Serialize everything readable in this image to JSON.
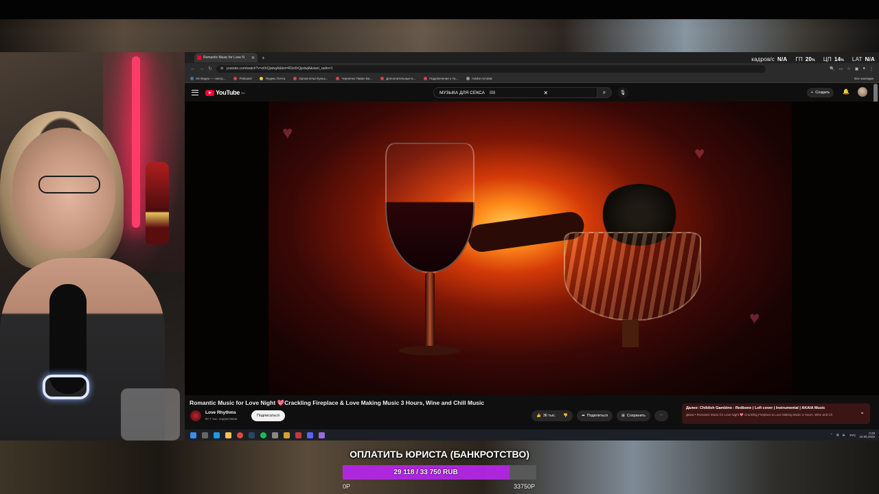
{
  "browser": {
    "tab_title": "Romantic Music for Love N",
    "url": "youtube.com/watch?v=zi0rQjwlwjA&list=RDzi0rQjwlwjA&start_radio=1",
    "bookmarks": [
      {
        "label": "VK Видео — смотр..."
      },
      {
        "label": "Pinboard"
      },
      {
        "label": "Яндекс Почта"
      },
      {
        "label": "Орлов Илья Куньк..."
      },
      {
        "label": "Черненко Павел Ва..."
      },
      {
        "label": "Дополнительные в..."
      },
      {
        "label": "Подключение к Ya..."
      },
      {
        "label": "Adobe Acrobat"
      }
    ],
    "all_bookmarks": "Все закладки"
  },
  "overlay": {
    "fps_label": "кадров/с",
    "fps_value": "N/A",
    "gpu_label": "ГП",
    "gpu_value": "20",
    "cpu_label": "ЦП",
    "cpu_value": "14",
    "lat_label": "LAT",
    "lat_value": "N/A"
  },
  "youtube": {
    "logo_text": "YouTube",
    "logo_region": "RU",
    "search_query": "МУЗЫКА ДЛЯ СЕКСА",
    "create_label": "Создать",
    "video_title": "Romantic Music for Love Night 💖Crackling Fireplace & Love Making Music 3 Hours, Wine and Chill Music",
    "channel_name": "Love Rhythms",
    "channel_subs": "87,7 тыс. подписчиков",
    "subscribe_label": "Подписаться",
    "likes": "36 тыс.",
    "share_label": "Поделиться",
    "save_label": "Сохранить",
    "next_title": "Далее: Childish Gambino - Redbone | Lofi cover | Instrumental | AKAIA Music",
    "next_sub": "Джем • Romantic Music for Love Night 💖 Crackling Fireplace & Love Making Music 3 Hours, Wine and Ch"
  },
  "taskbar": {
    "lang": "РУС",
    "time": "0:29",
    "date": "10.05.2025"
  },
  "donation": {
    "title": "ОПЛАТИТЬ ЮРИСТА (БАНКРОТСТВО)",
    "progress_text": "29 118 / 33 750 RUB",
    "current": 29118,
    "goal": 33750,
    "min_label": "0Р",
    "max_label": "33750Р",
    "color": "#b526e6"
  }
}
